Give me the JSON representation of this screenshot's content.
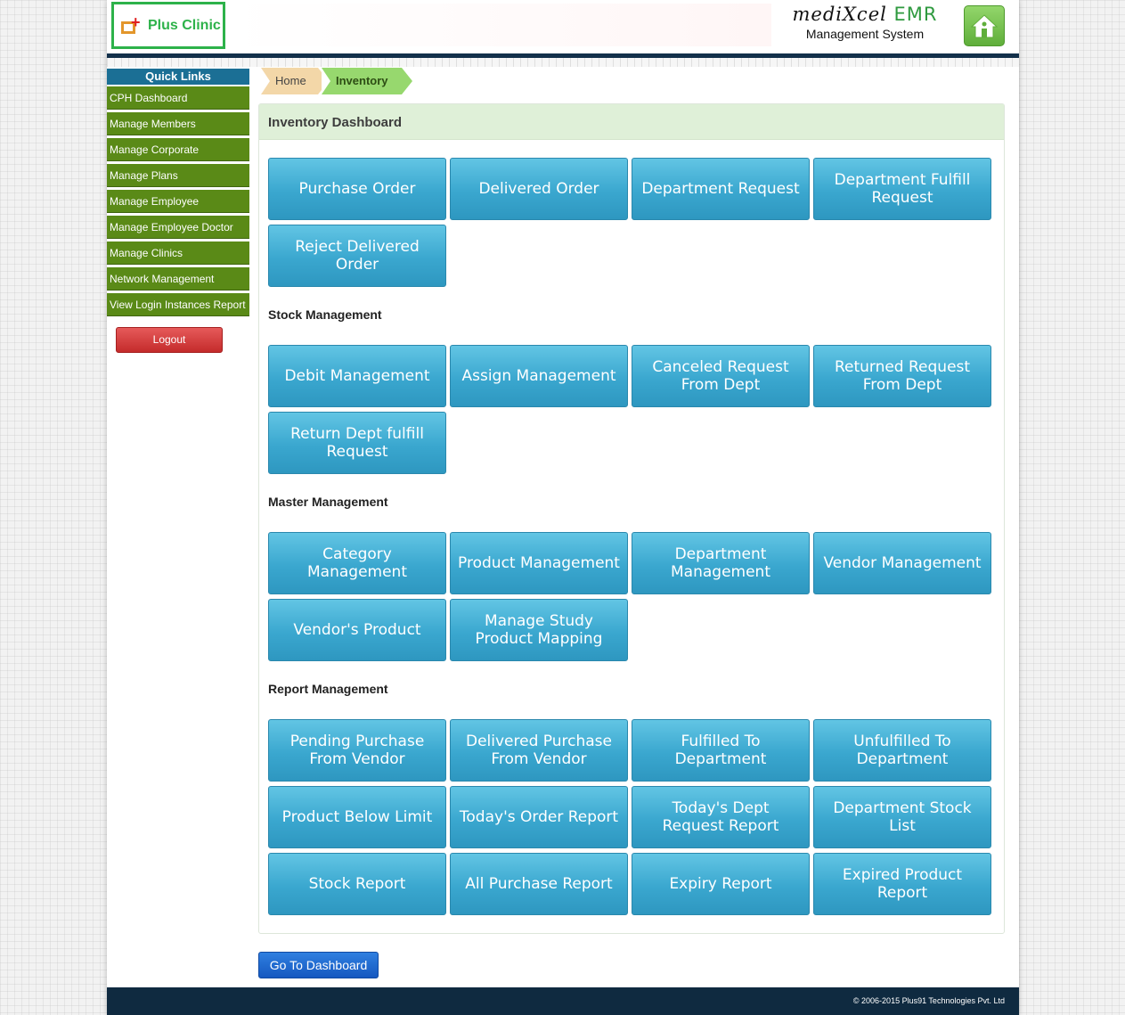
{
  "header": {
    "clinic_name": "Plus Clinic",
    "brand_title": "mediXcel",
    "brand_emr": "EMR",
    "brand_subtitle": "Management System"
  },
  "sidebar": {
    "title": "Quick Links",
    "items": [
      {
        "label": "CPH Dashboard"
      },
      {
        "label": "Manage Members"
      },
      {
        "label": "Manage Corporate"
      },
      {
        "label": "Manage Plans"
      },
      {
        "label": "Manage Employee"
      },
      {
        "label": "Manage Employee Doctor"
      },
      {
        "label": "Manage Clinics"
      },
      {
        "label": "Network Management"
      },
      {
        "label": "View Login Instances Report"
      }
    ],
    "logout_label": "Logout"
  },
  "breadcrumb": [
    "Home",
    "Inventory"
  ],
  "panel": {
    "title": "Inventory Dashboard",
    "sections": [
      {
        "title": "",
        "tiles": [
          "Purchase Order",
          "Delivered Order",
          "Department Request",
          "Department Fulfill Request",
          "Reject Delivered Order"
        ]
      },
      {
        "title": "Stock Management",
        "tiles": [
          "Debit Management",
          "Assign Management",
          "Canceled Request From Dept",
          "Returned Request From Dept",
          "Return Dept fulfill Request"
        ]
      },
      {
        "title": "Master Management",
        "tiles": [
          "Category Management",
          "Product Management",
          "Department Management",
          "Vendor Management",
          "Vendor's Product",
          "Manage Study Product Mapping"
        ]
      },
      {
        "title": "Report Management",
        "tiles": [
          "Pending Purchase From Vendor",
          "Delivered Purchase From Vendor",
          "Fulfilled To Department",
          "Unfulfilled To Department",
          "Product Below Limit",
          "Today's Order Report",
          "Today's Dept Request Report",
          "Department Stock List",
          "Stock Report",
          "All Purchase Report",
          "Expiry Report",
          "Expired Product Report"
        ]
      }
    ]
  },
  "go_dashboard_label": "Go To Dashboard",
  "footer": {
    "copyright": "© 2006-2015 Plus91 Technologies Pvt. Ltd"
  }
}
